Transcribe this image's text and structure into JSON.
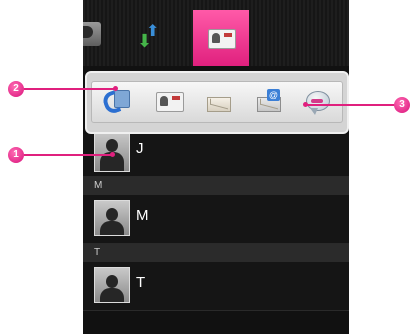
{
  "contacts": {
    "rows": [
      {
        "name": "J"
      },
      {
        "header": "M",
        "name": "M"
      },
      {
        "header": "T",
        "name": "T"
      }
    ]
  },
  "callouts": {
    "one": "1",
    "two": "2",
    "three": "3"
  },
  "colors": {
    "accent": "#e0207e",
    "list_bg": "#151515",
    "header_bg": "#2b2b2b"
  },
  "icons": {
    "tabs": [
      "contact-tab-icon",
      "sort-arrows-icon",
      "contacts-book-icon"
    ],
    "quick_actions": [
      "phone-icon",
      "contact-card-icon",
      "message-icon",
      "email-icon",
      "chat-icon"
    ]
  }
}
